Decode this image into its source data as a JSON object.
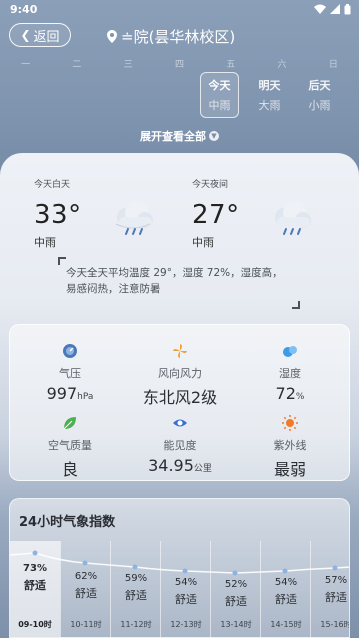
{
  "status": {
    "time": "9:40"
  },
  "header": {
    "back_label": "返回",
    "location": "≐院(昙华林校区)"
  },
  "weekdays": [
    "一",
    "二",
    "三",
    "四",
    "五",
    "六",
    "日"
  ],
  "day_tabs": [
    {
      "label": "今天",
      "cond": "中雨",
      "active": true
    },
    {
      "label": "明天",
      "cond": "大雨",
      "active": false
    },
    {
      "label": "后天",
      "cond": "小雨",
      "active": false
    }
  ],
  "expand_label": "展开查看全部",
  "today": {
    "day_label": "今天白天",
    "day_temp": "33°",
    "day_cond": "中雨",
    "night_label": "今天夜间",
    "night_temp": "27°",
    "night_cond": "中雨",
    "summary": "今天全天平均温度 29°，湿度 72%，湿度高，易感闷热，注意防暑"
  },
  "details": [
    {
      "name": "pressure",
      "label": "气压",
      "value": "997",
      "unit": "hPa",
      "icon": "pressure-icon",
      "color": "#4b79b8"
    },
    {
      "name": "wind",
      "label": "风向风力",
      "value": "东北风2级",
      "unit": "",
      "icon": "wind-icon",
      "color": "#f0a23a"
    },
    {
      "name": "humidity",
      "label": "湿度",
      "value": "72",
      "unit": "%",
      "icon": "humidity-icon",
      "color": "#3d9be6"
    },
    {
      "name": "air-quality",
      "label": "空气质量",
      "value": "良",
      "unit": "",
      "icon": "leaf-icon",
      "color": "#4caf50"
    },
    {
      "name": "visibility",
      "label": "能见度",
      "value": "34.95",
      "unit": "公里",
      "icon": "eye-icon",
      "color": "#3b6fd4"
    },
    {
      "name": "uv",
      "label": "紫外线",
      "value": "最弱",
      "unit": "",
      "icon": "sun-icon",
      "color": "#f07a2a"
    }
  ],
  "index": {
    "title": "24小时气象指数",
    "hours": [
      {
        "time": "09-10时",
        "pct": "73%",
        "level": "舒适"
      },
      {
        "time": "10-11时",
        "pct": "62%",
        "level": "舒适"
      },
      {
        "time": "11-12时",
        "pct": "59%",
        "level": "舒适"
      },
      {
        "time": "12-13时",
        "pct": "54%",
        "level": "舒适"
      },
      {
        "time": "13-14时",
        "pct": "52%",
        "level": "舒适"
      },
      {
        "time": "14-15时",
        "pct": "54%",
        "level": "舒适"
      },
      {
        "time": "15-16时",
        "pct": "57%",
        "level": "舒适"
      }
    ]
  }
}
